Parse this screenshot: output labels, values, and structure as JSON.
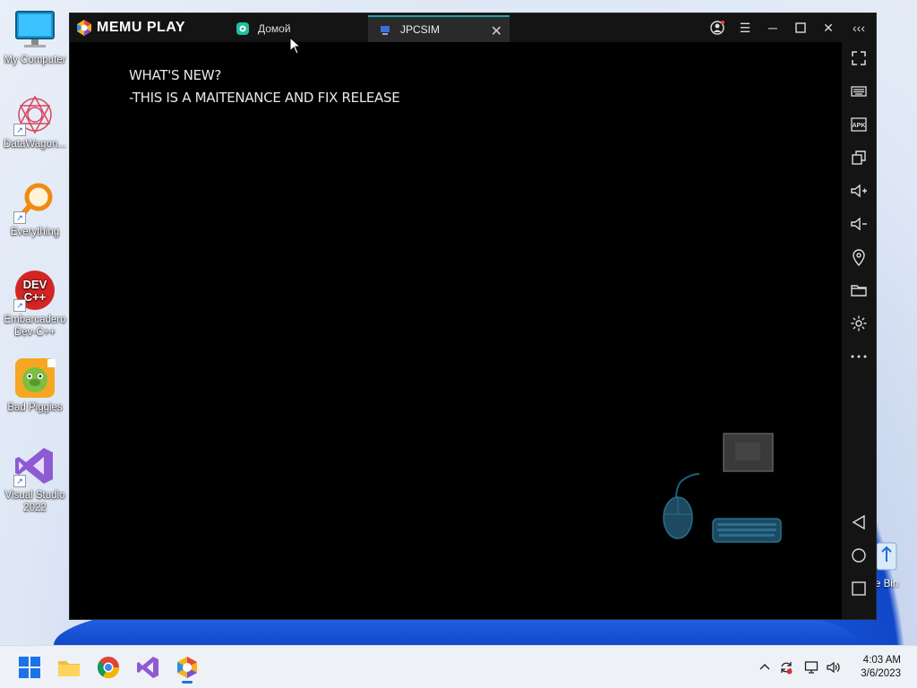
{
  "desktop": {
    "icons": [
      {
        "label": "My Computer",
        "icon": "monitor-icon"
      },
      {
        "label": "DataWagon...",
        "icon": "datawagon-icon"
      },
      {
        "label": "Everything",
        "icon": "magnifier-icon"
      },
      {
        "label": "Embarcadero Dev-C++",
        "label_line1": "Embarcadero",
        "label_line2": "Dev-C++",
        "icon": "devcpp-icon"
      },
      {
        "label": "Bad Piggies",
        "icon": "bad-piggies-icon"
      },
      {
        "label": "Visual Studio 2022",
        "label_line1": "Visual Studio",
        "label_line2": "2022",
        "icon": "visual-studio-icon"
      }
    ],
    "recycle_bin_partial_label": "e Bin"
  },
  "emulator": {
    "brand": "MEMU PLAY",
    "tabs": [
      {
        "label": "Домой",
        "active": false
      },
      {
        "label": "JPCSIM",
        "active": true
      }
    ],
    "screen": {
      "line1": "WHAT'S NEW?",
      "line2": "-THIS IS A MAITENANCE AND FIX RELEASE"
    },
    "sidebar_tools": [
      "fullscreen-icon",
      "keyboard-icon",
      "apk-icon",
      "multi-window-icon",
      "volume-up-icon",
      "volume-down-icon",
      "location-icon",
      "folder-icon",
      "settings-icon",
      "more-icon"
    ],
    "nav_buttons": [
      "back-icon",
      "home-icon",
      "recents-icon"
    ],
    "colors": {
      "accent": "#1fa3a6",
      "titlebar": "#141414"
    }
  },
  "taskbar": {
    "apps": [
      "start-icon",
      "file-explorer-icon",
      "chrome-icon",
      "visual-studio-icon",
      "memu-icon"
    ],
    "time": "4:03 AM",
    "date": "3/6/2023"
  }
}
